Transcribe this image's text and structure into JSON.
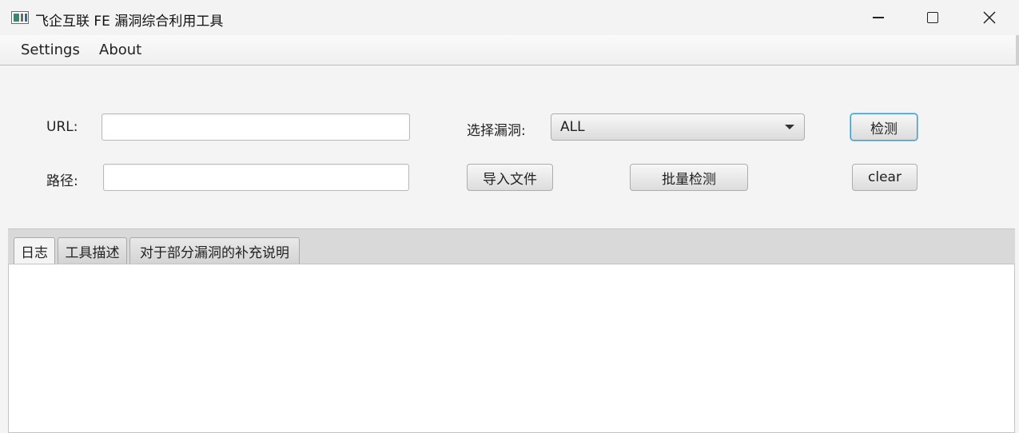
{
  "window": {
    "title": "飞企互联 FE 漏洞综合利用工具",
    "icon": "app-window-icon",
    "controls": [
      "minimize-icon",
      "maximize-icon",
      "close-icon"
    ]
  },
  "menu": {
    "settings": "Settings",
    "about": "About"
  },
  "form": {
    "url_label": "URL:",
    "url_value": "",
    "path_label": "路径:",
    "path_value": "",
    "vuln_label": "选择漏洞:",
    "vuln_selected": "ALL",
    "detect_button": "检测",
    "import_button": "导入文件",
    "batch_button": "批量检测",
    "clear_button": "clear"
  },
  "tabs": [
    {
      "label": "日志",
      "active": true
    },
    {
      "label": "工具描述",
      "active": false
    },
    {
      "label": "对于部分漏洞的补充说明",
      "active": false
    }
  ],
  "log": {
    "content": ""
  }
}
